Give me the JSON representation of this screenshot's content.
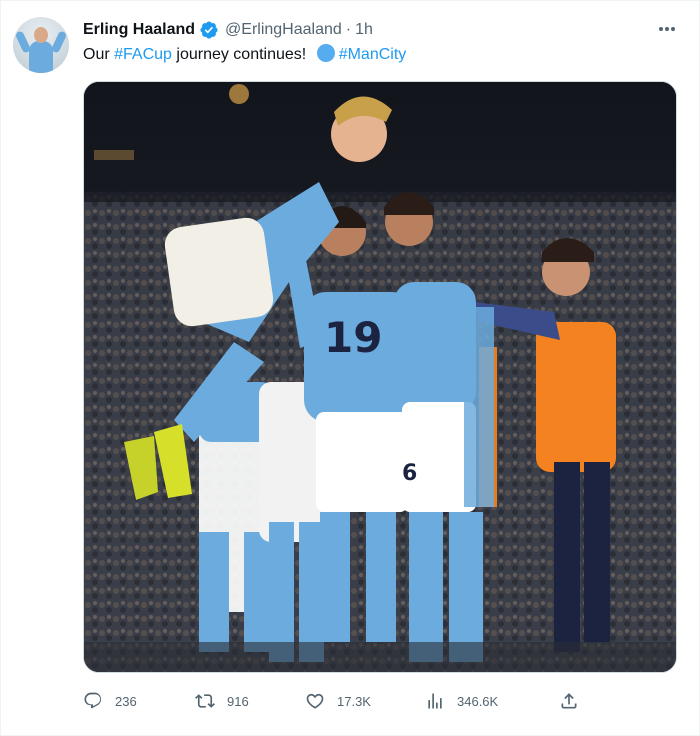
{
  "tweet": {
    "author_name": "Erling Haaland",
    "handle": "@ErlingHaaland",
    "separator": "·",
    "time": "1h",
    "text_before": "Our ",
    "hashtag_1": "#FACup",
    "text_middle": " journey continues! ",
    "hashtag_2": "#ManCity",
    "verified_icon": "verified-badge-icon",
    "more_icon": "more-horizontal-icon",
    "link_color": "#1d9bf0"
  },
  "actions": {
    "replies": "236",
    "retweets": "916",
    "likes": "17.3K",
    "views": "346.6K",
    "icons": [
      "reply-icon",
      "retweet-icon",
      "like-icon",
      "views-icon",
      "share-icon"
    ]
  },
  "colors": {
    "city_blue": "#6cabdd",
    "vest_orange": "#f58220",
    "muted_text": "#536471"
  }
}
